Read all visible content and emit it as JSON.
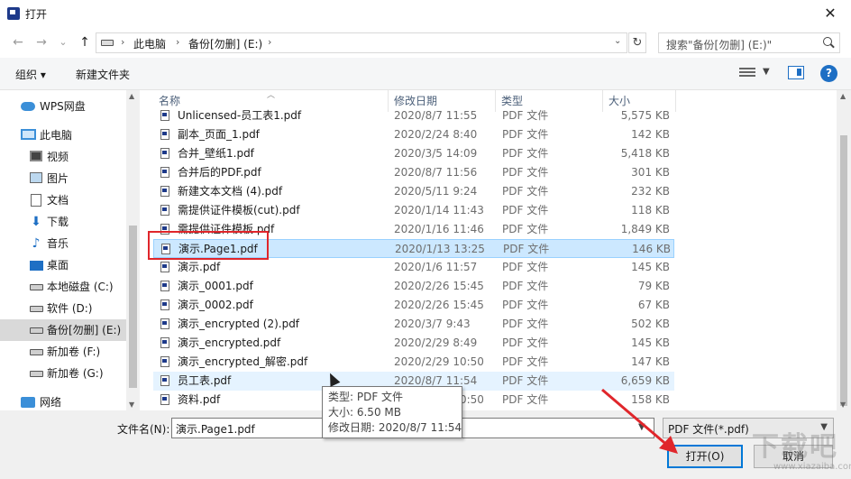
{
  "window": {
    "title": "打开",
    "close_glyph": "✕"
  },
  "nav_buttons": {
    "back": "←",
    "forward": "→",
    "recent": "⌄",
    "up": "↑"
  },
  "address": {
    "crumbs": [
      "此电脑",
      "备份[勿删] (E:)"
    ],
    "separator": "›",
    "dropdown_glyph": "⌄",
    "refresh_glyph": "↻"
  },
  "search": {
    "placeholder": "搜索\"备份[勿删] (E:)\""
  },
  "toolbar": {
    "organize": "组织 ▾",
    "new_folder": "新建文件夹",
    "help": "?"
  },
  "sidebar": {
    "items": [
      {
        "label": "WPS网盘",
        "icon": "cloud-icon"
      },
      {
        "label": "此电脑",
        "icon": "computer-icon"
      },
      {
        "label": "视频",
        "icon": "video-folder-icon"
      },
      {
        "label": "图片",
        "icon": "picture-folder-icon"
      },
      {
        "label": "文档",
        "icon": "document-folder-icon"
      },
      {
        "label": "下载",
        "icon": "download-folder-icon"
      },
      {
        "label": "音乐",
        "icon": "music-folder-icon"
      },
      {
        "label": "桌面",
        "icon": "desktop-folder-icon"
      },
      {
        "label": "本地磁盘 (C:)",
        "icon": "drive-icon"
      },
      {
        "label": "软件 (D:)",
        "icon": "drive-icon"
      },
      {
        "label": "备份[勿删] (E:)",
        "icon": "drive-icon"
      },
      {
        "label": "新加卷 (F:)",
        "icon": "drive-icon"
      },
      {
        "label": "新加卷 (G:)",
        "icon": "drive-icon"
      },
      {
        "label": "网络",
        "icon": "network-icon"
      }
    ],
    "selected_index": 10
  },
  "columns": {
    "name": "名称",
    "date": "修改日期",
    "type": "类型",
    "size": "大小"
  },
  "files": [
    {
      "name": "Unlicensed-员工表1.pdf",
      "date": "2020/8/7 11:55",
      "type": "PDF 文件",
      "size": "5,575 KB"
    },
    {
      "name": "副本_页面_1.pdf",
      "date": "2020/2/24 8:40",
      "type": "PDF 文件",
      "size": "142 KB"
    },
    {
      "name": "合并_壁纸1.pdf",
      "date": "2020/3/5 14:09",
      "type": "PDF 文件",
      "size": "5,418 KB"
    },
    {
      "name": "合并后的PDF.pdf",
      "date": "2020/8/7 11:56",
      "type": "PDF 文件",
      "size": "301 KB"
    },
    {
      "name": "新建文本文档 (4).pdf",
      "date": "2020/5/11 9:24",
      "type": "PDF 文件",
      "size": "232 KB"
    },
    {
      "name": "需提供证件模板(cut).pdf",
      "date": "2020/1/14 11:43",
      "type": "PDF 文件",
      "size": "118 KB"
    },
    {
      "name": "需提供证件模板.pdf",
      "date": "2020/1/16 11:46",
      "type": "PDF 文件",
      "size": "1,849 KB"
    },
    {
      "name": "演示.Page1.pdf",
      "date": "2020/1/13 13:25",
      "type": "PDF 文件",
      "size": "146 KB"
    },
    {
      "name": "演示.pdf",
      "date": "2020/1/6 11:57",
      "type": "PDF 文件",
      "size": "145 KB"
    },
    {
      "name": "演示_0001.pdf",
      "date": "2020/2/26 15:45",
      "type": "PDF 文件",
      "size": "79 KB"
    },
    {
      "name": "演示_0002.pdf",
      "date": "2020/2/26 15:45",
      "type": "PDF 文件",
      "size": "67 KB"
    },
    {
      "name": "演示_encrypted (2).pdf",
      "date": "2020/3/7 9:43",
      "type": "PDF 文件",
      "size": "502 KB"
    },
    {
      "name": "演示_encrypted.pdf",
      "date": "2020/2/29 8:49",
      "type": "PDF 文件",
      "size": "145 KB"
    },
    {
      "name": "演示_encrypted_解密.pdf",
      "date": "2020/2/29 10:50",
      "type": "PDF 文件",
      "size": "147 KB"
    },
    {
      "name": "员工表.pdf",
      "date": "2020/8/7 11:54",
      "type": "PDF 文件",
      "size": "6,659 KB"
    },
    {
      "name": "资料.pdf",
      "date": "2020/2/29 10:50",
      "type": "PDF 文件",
      "size": "158 KB"
    }
  ],
  "selected_file_index": 7,
  "hover_file_index": 14,
  "tooltip": {
    "type_line": "类型: PDF 文件",
    "size_line": "大小: 6.50 MB",
    "date_line": "修改日期: 2020/8/7 11:54"
  },
  "bottom": {
    "filename_label": "文件名(N):",
    "filename_value": "演示.Page1.pdf",
    "filter": "PDF 文件(*.pdf)",
    "open": "打开(O)",
    "cancel": "取消"
  },
  "watermark": {
    "main": "下载吧",
    "sub": "www.xiazaiba.com"
  },
  "colors": {
    "accent": "#0078d7",
    "highlight": "#e0262b",
    "selection": "#cce8ff"
  }
}
